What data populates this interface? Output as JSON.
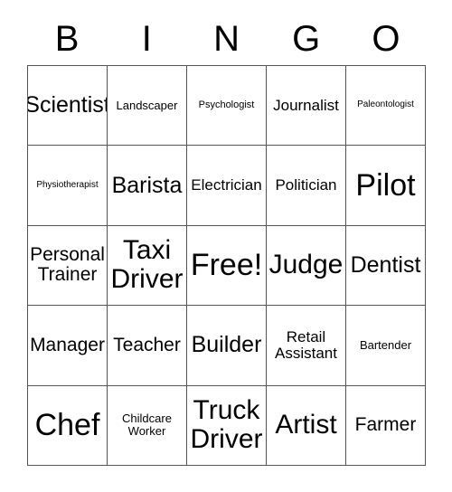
{
  "card": {
    "title": "BINGO",
    "header_letters": [
      "B",
      "I",
      "N",
      "G",
      "O"
    ],
    "colors": {
      "background": "#ffffff",
      "text": "#000000",
      "grid_line": "#555555"
    },
    "grid": {
      "rows": 5,
      "columns": 5,
      "free_space_label": "Free!",
      "free_space_position": "row3-col3"
    },
    "cells": [
      [
        {
          "label": "Scientist",
          "size": "lg",
          "lines": 1
        },
        {
          "label": "Landscaper",
          "size": "xs",
          "lines": 1
        },
        {
          "label": "Psychologist",
          "size": "xxs",
          "lines": 1
        },
        {
          "label": "Journalist",
          "size": "sm",
          "lines": 1
        },
        {
          "label": "Paleontologist",
          "size": "tiny",
          "lines": 1
        }
      ],
      [
        {
          "label": "Physiotherapist",
          "size": "tiny",
          "lines": 1
        },
        {
          "label": "Barista",
          "size": "lg",
          "lines": 1
        },
        {
          "label": "Electrician",
          "size": "sm",
          "lines": 1
        },
        {
          "label": "Politician",
          "size": "sm",
          "lines": 1
        },
        {
          "label": "Pilot",
          "size": "xxl",
          "lines": 1
        }
      ],
      [
        {
          "label": "Personal\nTrainer",
          "size": "md",
          "lines": 2
        },
        {
          "label": "Taxi\nDriver",
          "size": "xl",
          "lines": 2
        },
        {
          "label": "Free!",
          "size": "xxl",
          "lines": 1
        },
        {
          "label": "Judge",
          "size": "xl",
          "lines": 1
        },
        {
          "label": "Dentist",
          "size": "lg",
          "lines": 1
        }
      ],
      [
        {
          "label": "Manager",
          "size": "md",
          "lines": 1
        },
        {
          "label": "Teacher",
          "size": "md",
          "lines": 1
        },
        {
          "label": "Builder",
          "size": "lg",
          "lines": 1
        },
        {
          "label": "Retail\nAssistant",
          "size": "sm",
          "lines": 2
        },
        {
          "label": "Bartender",
          "size": "xs",
          "lines": 1
        }
      ],
      [
        {
          "label": "Chef",
          "size": "xxl",
          "lines": 1
        },
        {
          "label": "Childcare\nWorker",
          "size": "xs",
          "lines": 2
        },
        {
          "label": "Truck\nDriver",
          "size": "xl",
          "lines": 2
        },
        {
          "label": "Artist",
          "size": "xl",
          "lines": 1
        },
        {
          "label": "Farmer",
          "size": "md",
          "lines": 1
        }
      ]
    ]
  }
}
